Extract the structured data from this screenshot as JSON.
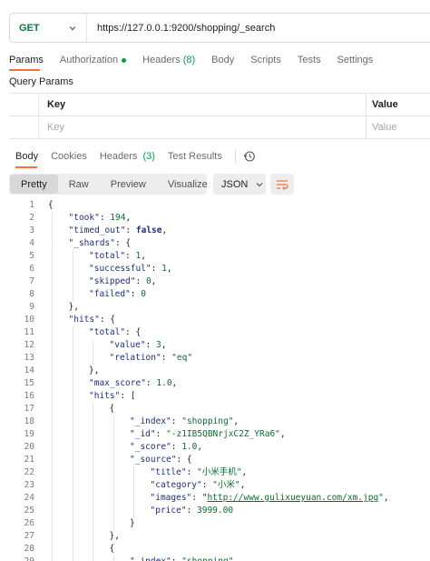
{
  "request": {
    "method": "GET",
    "url": "https://127.0.0.1:9200/shopping/_search",
    "tabs": [
      {
        "label": "Params",
        "active": true
      },
      {
        "label": "Authorization",
        "dot": true
      },
      {
        "label": "Headers",
        "count": "(8)"
      },
      {
        "label": "Body"
      },
      {
        "label": "Scripts"
      },
      {
        "label": "Tests"
      },
      {
        "label": "Settings"
      }
    ]
  },
  "query_params": {
    "title": "Query Params",
    "header_key": "Key",
    "header_value": "Value",
    "placeholder_key": "Key",
    "placeholder_value": "Value"
  },
  "response": {
    "tabs": [
      {
        "label": "Body",
        "active": true
      },
      {
        "label": "Cookies"
      },
      {
        "label": "Headers",
        "count": "(3)"
      },
      {
        "label": "Test Results"
      }
    ],
    "views": [
      "Pretty",
      "Raw",
      "Preview",
      "Visualize"
    ],
    "format": "JSON",
    "colors": {
      "accent": "#ff6c37",
      "green": "#0a9a4a",
      "key": "#1b2d8a",
      "string": "#0a6d30"
    },
    "lines": [
      {
        "n": "1",
        "indent": 0,
        "tokens": [
          [
            "p",
            "{"
          ]
        ]
      },
      {
        "n": "2",
        "indent": 1,
        "tokens": [
          [
            "k",
            "\"took\""
          ],
          [
            "p",
            ": "
          ],
          [
            "n",
            "194"
          ],
          [
            "p",
            ","
          ]
        ]
      },
      {
        "n": "3",
        "indent": 1,
        "tokens": [
          [
            "k",
            "\"timed_out\""
          ],
          [
            "p",
            ": "
          ],
          [
            "b",
            "false"
          ],
          [
            "p",
            ","
          ]
        ]
      },
      {
        "n": "4",
        "indent": 1,
        "tokens": [
          [
            "k",
            "\"_shards\""
          ],
          [
            "p",
            ": {"
          ]
        ]
      },
      {
        "n": "5",
        "indent": 2,
        "tokens": [
          [
            "k",
            "\"total\""
          ],
          [
            "p",
            ": "
          ],
          [
            "n",
            "1"
          ],
          [
            "p",
            ","
          ]
        ]
      },
      {
        "n": "6",
        "indent": 2,
        "tokens": [
          [
            "k",
            "\"successful\""
          ],
          [
            "p",
            ": "
          ],
          [
            "n",
            "1"
          ],
          [
            "p",
            ","
          ]
        ]
      },
      {
        "n": "7",
        "indent": 2,
        "tokens": [
          [
            "k",
            "\"skipped\""
          ],
          [
            "p",
            ": "
          ],
          [
            "n",
            "0"
          ],
          [
            "p",
            ","
          ]
        ]
      },
      {
        "n": "8",
        "indent": 2,
        "tokens": [
          [
            "k",
            "\"failed\""
          ],
          [
            "p",
            ": "
          ],
          [
            "n",
            "0"
          ]
        ]
      },
      {
        "n": "9",
        "indent": 1,
        "tokens": [
          [
            "p",
            "},"
          ]
        ]
      },
      {
        "n": "10",
        "indent": 1,
        "tokens": [
          [
            "k",
            "\"hits\""
          ],
          [
            "p",
            ": {"
          ]
        ]
      },
      {
        "n": "11",
        "indent": 2,
        "tokens": [
          [
            "k",
            "\"total\""
          ],
          [
            "p",
            ": {"
          ]
        ]
      },
      {
        "n": "12",
        "indent": 3,
        "tokens": [
          [
            "k",
            "\"value\""
          ],
          [
            "p",
            ": "
          ],
          [
            "n",
            "3"
          ],
          [
            "p",
            ","
          ]
        ]
      },
      {
        "n": "13",
        "indent": 3,
        "tokens": [
          [
            "k",
            "\"relation\""
          ],
          [
            "p",
            ": "
          ],
          [
            "s",
            "\"eq\""
          ]
        ]
      },
      {
        "n": "14",
        "indent": 2,
        "tokens": [
          [
            "p",
            "},"
          ]
        ]
      },
      {
        "n": "15",
        "indent": 2,
        "tokens": [
          [
            "k",
            "\"max_score\""
          ],
          [
            "p",
            ": "
          ],
          [
            "n",
            "1.0"
          ],
          [
            "p",
            ","
          ]
        ]
      },
      {
        "n": "16",
        "indent": 2,
        "tokens": [
          [
            "k",
            "\"hits\""
          ],
          [
            "p",
            ": ["
          ]
        ]
      },
      {
        "n": "17",
        "indent": 3,
        "tokens": [
          [
            "p",
            "{"
          ]
        ]
      },
      {
        "n": "18",
        "indent": 4,
        "tokens": [
          [
            "k",
            "\"_index\""
          ],
          [
            "p",
            ": "
          ],
          [
            "s",
            "\"shopping\""
          ],
          [
            "p",
            ","
          ]
        ]
      },
      {
        "n": "19",
        "indent": 4,
        "tokens": [
          [
            "k",
            "\"_id\""
          ],
          [
            "p",
            ": "
          ],
          [
            "s",
            "\"-z1IB5QBNrjxC2Z_YRa6\""
          ],
          [
            "p",
            ","
          ]
        ]
      },
      {
        "n": "20",
        "indent": 4,
        "tokens": [
          [
            "k",
            "\"_score\""
          ],
          [
            "p",
            ": "
          ],
          [
            "n",
            "1.0"
          ],
          [
            "p",
            ","
          ]
        ]
      },
      {
        "n": "21",
        "indent": 4,
        "tokens": [
          [
            "k",
            "\"_source\""
          ],
          [
            "p",
            ": {"
          ]
        ]
      },
      {
        "n": "22",
        "indent": 5,
        "tokens": [
          [
            "k",
            "\"title\""
          ],
          [
            "p",
            ": "
          ],
          [
            "s",
            "\"小米手机\""
          ],
          [
            "p",
            ","
          ]
        ]
      },
      {
        "n": "23",
        "indent": 5,
        "tokens": [
          [
            "k",
            "\"category\""
          ],
          [
            "p",
            ": "
          ],
          [
            "s",
            "\"小米\""
          ],
          [
            "p",
            ","
          ]
        ]
      },
      {
        "n": "24",
        "indent": 5,
        "tokens": [
          [
            "k",
            "\"images\""
          ],
          [
            "p",
            ": \""
          ],
          [
            "u",
            "http://www.gulixueyuan.com/xm.jpg"
          ],
          [
            "s",
            "\""
          ],
          [
            "p",
            ","
          ]
        ]
      },
      {
        "n": "25",
        "indent": 5,
        "tokens": [
          [
            "k",
            "\"price\""
          ],
          [
            "p",
            ": "
          ],
          [
            "n",
            "3999.00"
          ]
        ]
      },
      {
        "n": "26",
        "indent": 4,
        "tokens": [
          [
            "p",
            "}"
          ]
        ]
      },
      {
        "n": "27",
        "indent": 3,
        "tokens": [
          [
            "p",
            "},"
          ]
        ]
      },
      {
        "n": "28",
        "indent": 3,
        "tokens": [
          [
            "p",
            "{"
          ]
        ]
      },
      {
        "n": "29",
        "indent": 4,
        "tokens": [
          [
            "k",
            "\"_index\""
          ],
          [
            "p",
            ": "
          ],
          [
            "s",
            "\"shopping\""
          ]
        ]
      }
    ]
  }
}
